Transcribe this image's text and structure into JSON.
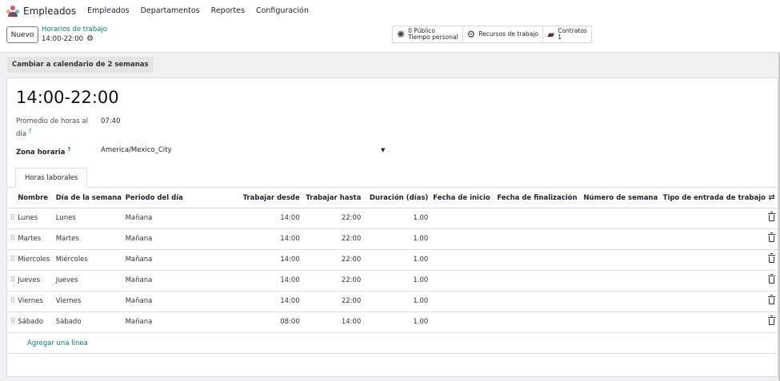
{
  "topbar": {
    "app_name": "Empleados",
    "menu": [
      "Empleados",
      "Departamentos",
      "Reportes",
      "Configuración"
    ]
  },
  "control": {
    "new_label": "Nuevo",
    "breadcrumb": "Horarios de trabajo",
    "record": "14:00-22:00"
  },
  "smart_buttons": {
    "publico": {
      "line1": "0 Público",
      "line2": "Tiempo personal",
      "icon": "sun-gear-icon"
    },
    "recursos": {
      "label": "Recursos de trabajo",
      "icon": "gears-icon"
    },
    "contratos": {
      "line1": "Contratos",
      "line2": "1",
      "icon": "book-icon"
    }
  },
  "switch_calendar": "Cambiar a calendario de 2 semanas",
  "form": {
    "title": "14:00-22:00",
    "avg_label_1": "Promedio de horas al",
    "avg_label_2": "día",
    "avg_value": "07:40",
    "tz_label": "Zona horaria",
    "tz_value": "America/Mexico_City",
    "help_mark": "?"
  },
  "tab": "Horas laborales",
  "table": {
    "headers": [
      "Nombre",
      "Día de la semana",
      "Periodo del día",
      "Trabajar desde",
      "Trabajar hasta",
      "Duración (días)",
      "Fecha de inicio",
      "Fecha de finalización",
      "Número de semana",
      "Tipo de entrada de trabajo"
    ],
    "rows": [
      {
        "name": "Lunes",
        "day": "Lunes",
        "period": "Mañana",
        "from": "14:00",
        "to": "22:00",
        "duration": "1.00"
      },
      {
        "name": "Martes",
        "day": "Martes",
        "period": "Mañana",
        "from": "14:00",
        "to": "22:00",
        "duration": "1.00"
      },
      {
        "name": "Miercoles",
        "day": "Miércoles",
        "period": "Mañana",
        "from": "14:00",
        "to": "22:00",
        "duration": "1.00"
      },
      {
        "name": "Jueves",
        "day": "Jueves",
        "period": "Mañana",
        "from": "14:00",
        "to": "22:00",
        "duration": "1.00"
      },
      {
        "name": "Viernes",
        "day": "Viernes",
        "period": "Mañana",
        "from": "14:00",
        "to": "22:00",
        "duration": "1.00"
      },
      {
        "name": "Sábado",
        "day": "Sábado",
        "period": "Mañana",
        "from": "08:00",
        "to": "14:00",
        "duration": "1.00"
      }
    ],
    "add_line": "Agregar una línea"
  },
  "colors": {
    "accent": "#017e84",
    "logo_red": "#e4566b",
    "logo_purple": "#714b67",
    "logo_orange": "#f4a261"
  }
}
